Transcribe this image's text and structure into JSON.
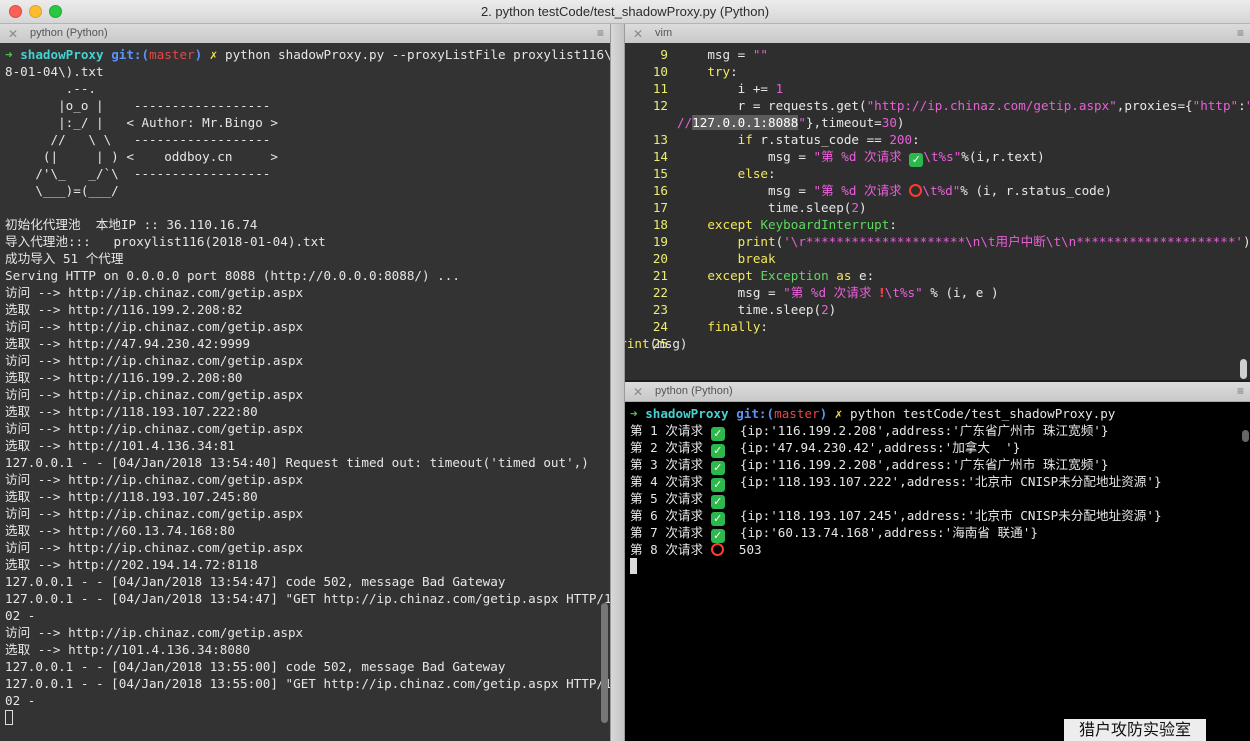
{
  "window": {
    "title": "2. python testCode/test_shadowProxy.py (Python)"
  },
  "tabs": {
    "left": {
      "label": "python (Python)",
      "close": "✕",
      "menu": "≡"
    },
    "vim": {
      "label": "vim",
      "close": "✕",
      "menu": "≡"
    },
    "term": {
      "label": "python (Python)",
      "close": "✕",
      "menu": "≡"
    }
  },
  "left": {
    "prompt": {
      "arrow": "➜",
      "dir": "shadowProxy",
      "git": "git:(",
      "branch": "master",
      "git_close": ")",
      "x": "✗",
      "command": "python shadowProxy.py --proxyListFile proxylist116\\(201"
    },
    "lines": [
      "8-01-04\\).txt",
      "        .--.",
      "       |o_o |    ------------------",
      "       |:_/ |   < Author: Mr.Bingo >",
      "      //   \\ \\   ------------------",
      "     (|     | ) <    oddboy.cn     >",
      "    /'\\_   _/`\\  ------------------",
      "    \\___)=(___/",
      "",
      "初始化代理池  本地IP :: 36.110.16.74",
      "导入代理池:::   proxylist116(2018-01-04).txt",
      "成功导入 51 个代理",
      "Serving HTTP on 0.0.0.0 port 8088 (http://0.0.0.0:8088/) ...",
      "访问 --> http://ip.chinaz.com/getip.aspx",
      "选取 --> http://116.199.2.208:82",
      "访问 --> http://ip.chinaz.com/getip.aspx",
      "选取 --> http://47.94.230.42:9999",
      "访问 --> http://ip.chinaz.com/getip.aspx",
      "选取 --> http://116.199.2.208:80",
      "访问 --> http://ip.chinaz.com/getip.aspx",
      "选取 --> http://118.193.107.222:80",
      "访问 --> http://ip.chinaz.com/getip.aspx",
      "选取 --> http://101.4.136.34:81",
      "127.0.0.1 - - [04/Jan/2018 13:54:40] Request timed out: timeout('timed out',)",
      "访问 --> http://ip.chinaz.com/getip.aspx",
      "选取 --> http://118.193.107.245:80",
      "访问 --> http://ip.chinaz.com/getip.aspx",
      "选取 --> http://60.13.74.168:80",
      "访问 --> http://ip.chinaz.com/getip.aspx",
      "选取 --> http://202.194.14.72:8118",
      "127.0.0.1 - - [04/Jan/2018 13:54:47] code 502, message Bad Gateway",
      "127.0.0.1 - - [04/Jan/2018 13:54:47] \"GET http://ip.chinaz.com/getip.aspx HTTP/1.1\" 5",
      "02 -",
      "访问 --> http://ip.chinaz.com/getip.aspx",
      "选取 --> http://101.4.136.34:8080",
      "127.0.0.1 - - [04/Jan/2018 13:55:00] code 502, message Bad Gateway",
      "127.0.0.1 - - [04/Jan/2018 13:55:00] \"GET http://ip.chinaz.com/getip.aspx HTTP/1.1\" 5",
      "02 -"
    ]
  },
  "vim": {
    "lines": [
      {
        "n": "9",
        "segs": [
          [
            "    msg = ",
            ""
          ],
          [
            "\"\"",
            "str"
          ]
        ]
      },
      {
        "n": "10",
        "segs": [
          [
            "    ",
            ""
          ],
          [
            "try",
            "kw"
          ],
          [
            ":",
            ""
          ]
        ]
      },
      {
        "n": "11",
        "segs": [
          [
            "        i += ",
            ""
          ],
          [
            "1",
            "str"
          ]
        ]
      },
      {
        "n": "12",
        "segs": [
          [
            "        r = requests.get(",
            ""
          ],
          [
            "\"http://ip.chinaz.com/getip.aspx\"",
            "str"
          ],
          [
            ",proxies={",
            ""
          ],
          [
            "\"http\"",
            "str"
          ],
          [
            ":",
            ""
          ],
          [
            "\"http:",
            "str"
          ]
        ]
      },
      {
        "n": "",
        "segs": [
          [
            "//",
            "str"
          ],
          [
            "127.0.0.1:8088",
            "hl"
          ],
          [
            "\"",
            "str"
          ],
          [
            "},timeout=",
            ""
          ],
          [
            "30",
            "str"
          ],
          [
            ")",
            ""
          ]
        ]
      },
      {
        "n": "13",
        "segs": [
          [
            "        ",
            ""
          ],
          [
            "if",
            "kw"
          ],
          [
            " r.status_code == ",
            ""
          ],
          [
            "200",
            "str"
          ],
          [
            ":",
            ""
          ]
        ]
      },
      {
        "n": "14",
        "segs": [
          [
            "            msg = ",
            ""
          ],
          [
            "\"第 %d 次请求 ",
            "str"
          ],
          [
            "✓",
            "ok"
          ],
          [
            "\\t%s\"",
            "str"
          ],
          [
            "%(i,r.text)",
            ""
          ]
        ]
      },
      {
        "n": "15",
        "segs": [
          [
            "        ",
            ""
          ],
          [
            "else",
            "kw"
          ],
          [
            ":",
            ""
          ]
        ]
      },
      {
        "n": "16",
        "segs": [
          [
            "            msg = ",
            ""
          ],
          [
            "\"第 %d 次请求 ",
            "str"
          ],
          [
            "",
            "no"
          ],
          [
            "\\t%d\"",
            "str"
          ],
          [
            "% (i, r.status_code)",
            ""
          ]
        ]
      },
      {
        "n": "17",
        "segs": [
          [
            "            time.sleep(",
            ""
          ],
          [
            "2",
            "str"
          ],
          [
            ")",
            ""
          ]
        ]
      },
      {
        "n": "18",
        "segs": [
          [
            "    ",
            ""
          ],
          [
            "except",
            "kw"
          ],
          [
            " ",
            ""
          ],
          [
            "KeyboardInterrupt",
            "exc"
          ],
          [
            ":",
            ""
          ]
        ]
      },
      {
        "n": "19",
        "segs": [
          [
            "        ",
            ""
          ],
          [
            "print",
            "kw"
          ],
          [
            "(",
            ""
          ],
          [
            "'\\r*********************\\n\\t用户中断\\t\\n*********************'",
            "str"
          ],
          [
            ")",
            ""
          ]
        ]
      },
      {
        "n": "20",
        "segs": [
          [
            "        ",
            ""
          ],
          [
            "break",
            "kw"
          ]
        ]
      },
      {
        "n": "21",
        "segs": [
          [
            "    ",
            ""
          ],
          [
            "except",
            "kw"
          ],
          [
            " ",
            ""
          ],
          [
            "Exception",
            "exc"
          ],
          [
            " ",
            ""
          ],
          [
            "as",
            "kw"
          ],
          [
            " e:",
            ""
          ]
        ]
      },
      {
        "n": "22",
        "segs": [
          [
            "        msg = ",
            ""
          ],
          [
            "\"第 %d 次请求 ",
            "str"
          ],
          [
            "!",
            "bang"
          ],
          [
            "\\t%s\"",
            "str"
          ],
          [
            " % (i, e )",
            ""
          ]
        ]
      },
      {
        "n": "23",
        "segs": [
          [
            "        time.sleep(",
            ""
          ],
          [
            "2",
            "str"
          ],
          [
            ")",
            ""
          ]
        ]
      },
      {
        "n": "24",
        "segs": [
          [
            "    ",
            ""
          ],
          [
            "finally",
            "kw"
          ],
          [
            ":",
            ""
          ]
        ]
      },
      {
        "n": "25",
        "segs": [
          [
            "        ",
            ""
          ],
          [
            "print",
            "kw"
          ],
          [
            "(msg)",
            ""
          ]
        ]
      }
    ]
  },
  "term": {
    "prompt": {
      "arrow": "➜",
      "dir": "shadowProxy",
      "git": "git:(",
      "branch": "master",
      "git_close": ")",
      "x": "✗",
      "command": "python testCode/test_shadowProxy.py"
    },
    "rows": [
      {
        "label": "第 1 次请求",
        "status": "ok",
        "text": "{ip:'116.199.2.208',address:'广东省广州市 珠江宽频'}"
      },
      {
        "label": "第 2 次请求",
        "status": "ok",
        "text": "{ip:'47.94.230.42',address:'加拿大  '}"
      },
      {
        "label": "第 3 次请求",
        "status": "ok",
        "text": "{ip:'116.199.2.208',address:'广东省广州市 珠江宽频'}"
      },
      {
        "label": "第 4 次请求",
        "status": "ok",
        "text": "{ip:'118.193.107.222',address:'北京市 CNISP未分配地址资源'}"
      },
      {
        "label": "第 5 次请求",
        "status": "ok",
        "text": ""
      },
      {
        "label": "第 6 次请求",
        "status": "ok",
        "text": "{ip:'118.193.107.245',address:'北京市 CNISP未分配地址资源'}"
      },
      {
        "label": "第 7 次请求",
        "status": "ok",
        "text": "{ip:'60.13.74.168',address:'海南省 联通'}"
      },
      {
        "label": "第 8 次请求",
        "status": "fail",
        "text": "503"
      }
    ]
  },
  "watermark": "猎户攻防实验室"
}
